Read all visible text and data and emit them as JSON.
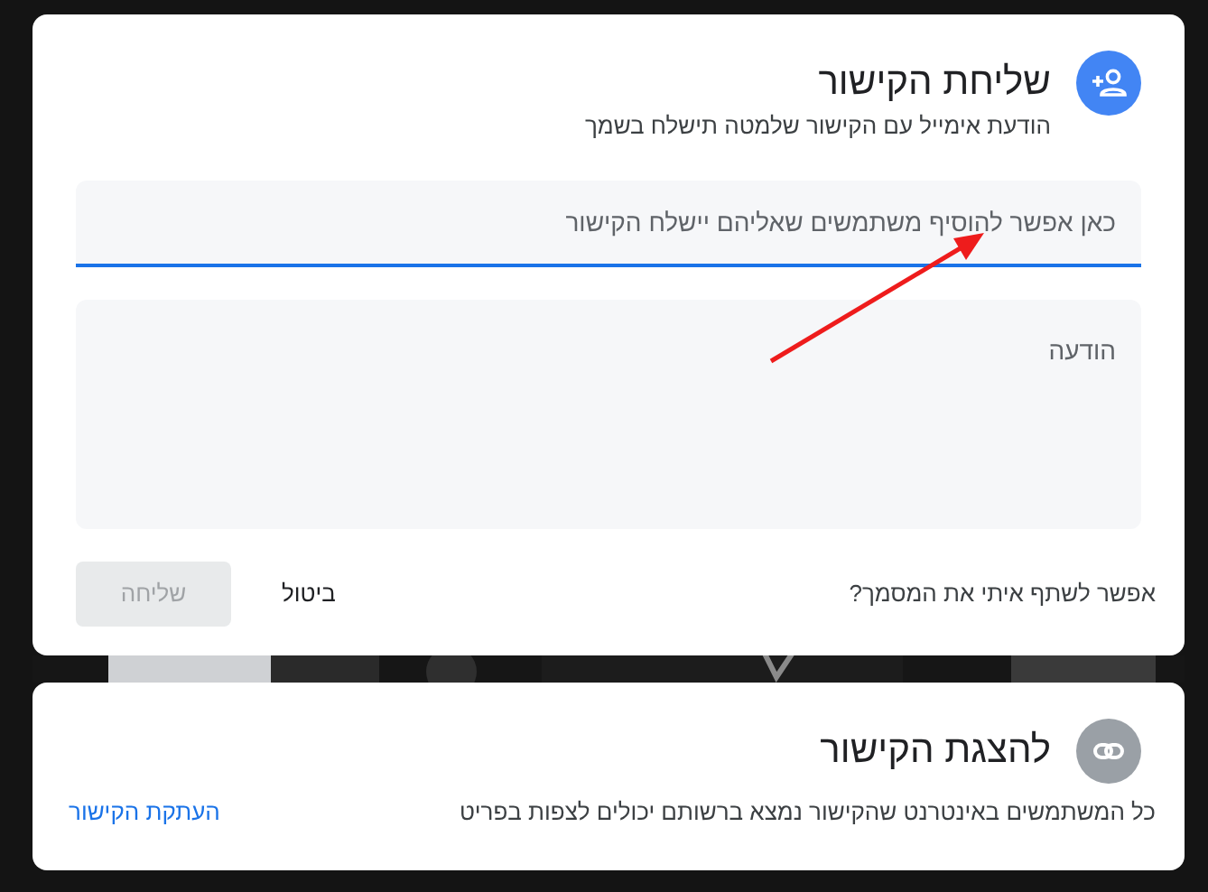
{
  "share_dialog": {
    "title": "שליחת הקישור",
    "subtitle": "הודעת אימייל עם הקישור שלמטה תישלח בשמך",
    "recipients_field": {
      "placeholder": "כאן אפשר להוסיף משתמשים שאליהם יישלח הקישור",
      "focused": true
    },
    "message_field": {
      "placeholder": "הודעה"
    },
    "question": "אפשר לשתף איתי את המסמך?",
    "cancel_button": "ביטול",
    "send_button": {
      "label": "שליחה",
      "disabled": true
    }
  },
  "link_card": {
    "title": "להצגת הקישור",
    "description": "כל המשתמשים באינטרנט שהקישור נמצא ברשותם יכולים לצפות בפריט",
    "copy_link": "העתקת הקישור"
  }
}
